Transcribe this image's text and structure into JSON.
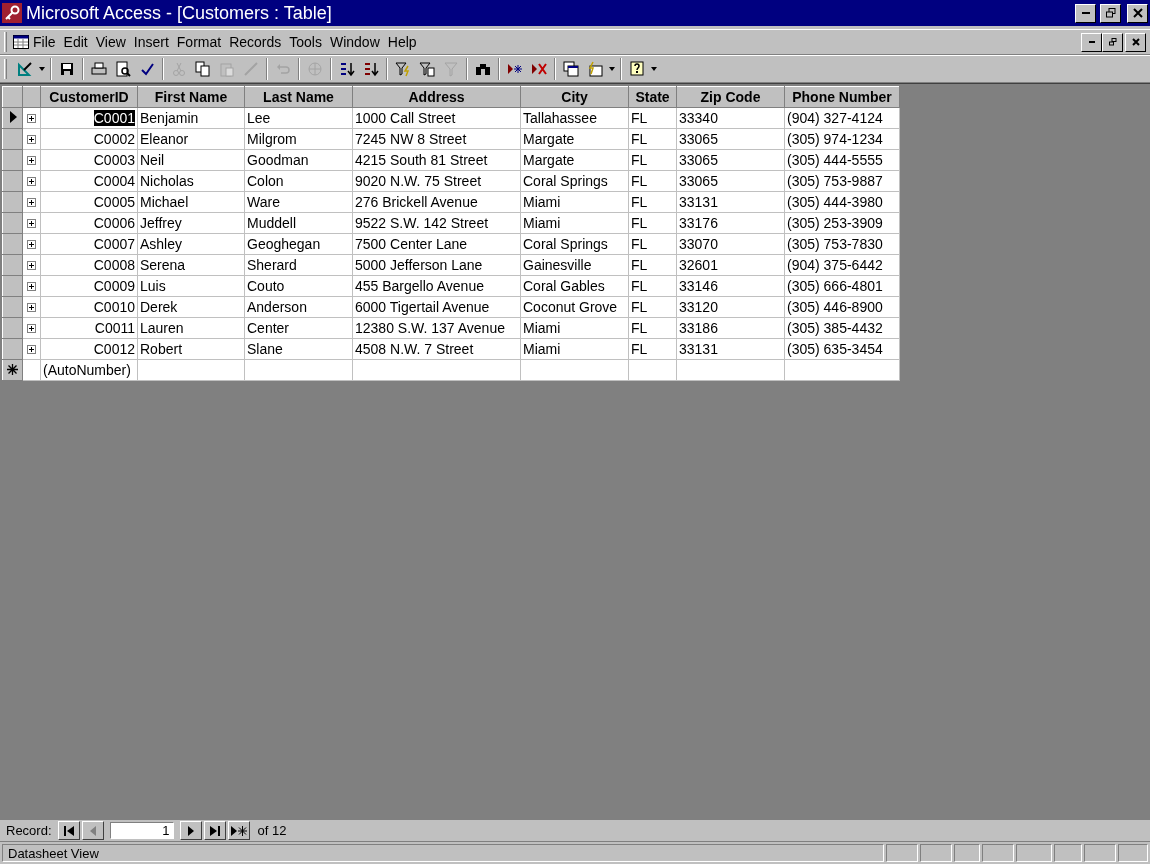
{
  "window": {
    "title": "Microsoft Access - [Customers : Table]"
  },
  "menu": [
    "File",
    "Edit",
    "View",
    "Insert",
    "Format",
    "Records",
    "Tools",
    "Window",
    "Help"
  ],
  "toolbar": [
    {
      "kind": "design",
      "disabled": false
    },
    {
      "kind": "dropdown",
      "disabled": false
    },
    {
      "kind": "separator"
    },
    {
      "kind": "save",
      "disabled": false
    },
    {
      "kind": "separator"
    },
    {
      "kind": "print",
      "disabled": false
    },
    {
      "kind": "preview",
      "disabled": false
    },
    {
      "kind": "spelling",
      "disabled": false
    },
    {
      "kind": "separator"
    },
    {
      "kind": "cut",
      "disabled": true
    },
    {
      "kind": "copy",
      "disabled": false
    },
    {
      "kind": "paste",
      "disabled": true
    },
    {
      "kind": "brush",
      "disabled": true
    },
    {
      "kind": "separator"
    },
    {
      "kind": "undo",
      "disabled": true
    },
    {
      "kind": "separator"
    },
    {
      "kind": "globe",
      "disabled": true
    },
    {
      "kind": "separator"
    },
    {
      "kind": "sort-asc",
      "disabled": false
    },
    {
      "kind": "sort-desc",
      "disabled": false
    },
    {
      "kind": "separator"
    },
    {
      "kind": "filter-selection",
      "disabled": false
    },
    {
      "kind": "filter-form",
      "disabled": false
    },
    {
      "kind": "filter",
      "disabled": true
    },
    {
      "kind": "separator"
    },
    {
      "kind": "find",
      "disabled": false
    },
    {
      "kind": "separator"
    },
    {
      "kind": "new-record",
      "disabled": false
    },
    {
      "kind": "delete-record",
      "disabled": false
    },
    {
      "kind": "separator"
    },
    {
      "kind": "window",
      "disabled": false
    },
    {
      "kind": "new-object",
      "disabled": false
    },
    {
      "kind": "dropdown",
      "disabled": false
    },
    {
      "kind": "separator"
    },
    {
      "kind": "help",
      "disabled": false
    },
    {
      "kind": "dropdown",
      "disabled": false
    }
  ],
  "table": {
    "columns": [
      "CustomerID",
      "First Name",
      "Last Name",
      "Address",
      "City",
      "State",
      "Zip Code",
      "Phone Number"
    ],
    "rows": [
      {
        "current": true,
        "cells": [
          "C0001",
          "Benjamin",
          "Lee",
          "1000 Call Street",
          "Tallahassee",
          "FL",
          "33340",
          "(904) 327-4124"
        ]
      },
      {
        "current": false,
        "cells": [
          "C0002",
          "Eleanor",
          "Milgrom",
          "7245 NW 8 Street",
          "Margate",
          "FL",
          "33065",
          "(305) 974-1234"
        ]
      },
      {
        "current": false,
        "cells": [
          "C0003",
          "Neil",
          "Goodman",
          "4215 South 81 Street",
          "Margate",
          "FL",
          "33065",
          "(305) 444-5555"
        ]
      },
      {
        "current": false,
        "cells": [
          "C0004",
          "Nicholas",
          "Colon",
          "9020 N.W. 75 Street",
          "Coral Springs",
          "FL",
          "33065",
          "(305) 753-9887"
        ]
      },
      {
        "current": false,
        "cells": [
          "C0005",
          "Michael",
          "Ware",
          "276 Brickell Avenue",
          "Miami",
          "FL",
          "33131",
          "(305) 444-3980"
        ]
      },
      {
        "current": false,
        "cells": [
          "C0006",
          "Jeffrey",
          "Muddell",
          "9522 S.W. 142 Street",
          "Miami",
          "FL",
          "33176",
          "(305) 253-3909"
        ]
      },
      {
        "current": false,
        "cells": [
          "C0007",
          "Ashley",
          "Geoghegan",
          "7500 Center Lane",
          "Coral Springs",
          "FL",
          "33070",
          "(305) 753-7830"
        ]
      },
      {
        "current": false,
        "cells": [
          "C0008",
          "Serena",
          "Sherard",
          "5000 Jefferson Lane",
          "Gainesville",
          "FL",
          "32601",
          "(904) 375-6442"
        ]
      },
      {
        "current": false,
        "cells": [
          "C0009",
          "Luis",
          "Couto",
          "455 Bargello Avenue",
          "Coral Gables",
          "FL",
          "33146",
          "(305) 666-4801"
        ]
      },
      {
        "current": false,
        "cells": [
          "C0010",
          "Derek",
          "Anderson",
          "6000 Tigertail Avenue",
          "Coconut Grove",
          "FL",
          "33120",
          "(305) 446-8900"
        ]
      },
      {
        "current": false,
        "cells": [
          "C0011",
          "Lauren",
          "Center",
          "12380 S.W. 137 Avenue",
          "Miami",
          "FL",
          "33186",
          "(305) 385-4432"
        ]
      },
      {
        "current": false,
        "cells": [
          "C0012",
          "Robert",
          "Slane",
          "4508 N.W. 7 Street",
          "Miami",
          "FL",
          "33131",
          "(305) 635-3454"
        ]
      }
    ],
    "new_row": "(AutoNumber)"
  },
  "navigator": {
    "label": "Record:",
    "value": "1",
    "total": "of 12"
  },
  "status_bar": {
    "text": "Datasheet View"
  }
}
